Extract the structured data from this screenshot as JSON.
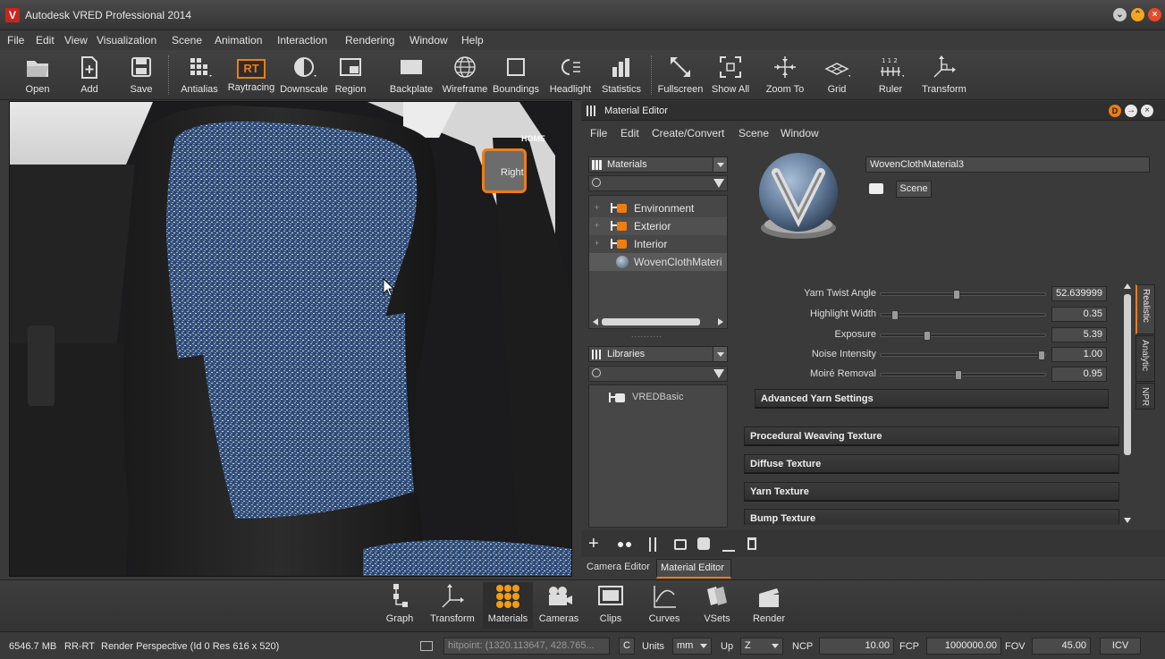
{
  "window": {
    "title": "Autodesk VRED Professional 2014",
    "logo_letter": "V"
  },
  "menubar": [
    "File",
    "Edit",
    "View",
    "Visualization",
    "Scene",
    "Animation",
    "Interaction",
    "Rendering",
    "Window",
    "Help"
  ],
  "toolbar": {
    "open": "Open",
    "add": "Add",
    "save": "Save",
    "antialias": "Antialias",
    "raytracing": "Raytracing",
    "raytracing_badge": "RT",
    "downscale": "Downscale",
    "region": "Region",
    "backplate": "Backplate",
    "wireframe": "Wireframe",
    "boundings": "Boundings",
    "headlight": "Headlight",
    "statistics": "Statistics",
    "fullscreen": "Fullscreen",
    "show_all": "Show All",
    "zoom_to": "Zoom To",
    "grid": "Grid",
    "ruler": "Ruler",
    "ruler_digits": "1 1 2",
    "transform": "Transform"
  },
  "viewport": {
    "navcube_face": "Right",
    "navcube_home": "HOME"
  },
  "material_editor": {
    "title": "Material Editor",
    "title_badge": "D",
    "menu": [
      "File",
      "Edit",
      "Create/Convert",
      "Scene",
      "Window"
    ],
    "materials_combo": "Materials",
    "material_tree": [
      "Environment",
      "Exterior",
      "Interior",
      "WovenClothMateri"
    ],
    "scrollbar_dots": "..........",
    "libraries_combo": "Libraries",
    "library_tree": [
      "VREDBasic"
    ],
    "material_name": "WovenClothMaterial3",
    "scene_button": "Scene",
    "properties": [
      {
        "label": "Yarn Twist Angle",
        "value": "52.639999",
        "level": 0.46
      },
      {
        "label": "Highlight Width",
        "value": "0.35",
        "level": 0.07
      },
      {
        "label": "Exposure",
        "value": "5.39",
        "level": 0.27
      },
      {
        "label": "Noise Intensity",
        "value": "1.00",
        "level": 1.0
      },
      {
        "label": "Moiré Removal",
        "value": "0.95",
        "level": 0.47
      }
    ],
    "sections": [
      "Advanced Yarn Settings",
      "Procedural Weaving Texture",
      "Diffuse Texture",
      "Yarn Texture",
      "Bump Texture"
    ],
    "side_tabs": [
      "Realistic",
      "Analytic",
      "NPR"
    ],
    "bottom_tabs": [
      "Camera Editor",
      "Material Editor"
    ]
  },
  "dock": [
    "Graph",
    "Transform",
    "Materials",
    "Cameras",
    "Clips",
    "Curves",
    "VSets",
    "Render"
  ],
  "statusbar": {
    "memory": "6546.7 MB",
    "mode": "RR-RT",
    "render_info": "Render Perspective (Id 0 Res 616 x 520)",
    "hitpoint": "hitpoint: (1320.113647, 428.765...",
    "c_button": "C",
    "units_label": "Units",
    "units_value": "mm",
    "up_label": "Up",
    "up_value": "Z",
    "ncp_label": "NCP",
    "ncp_value": "10.00",
    "fcp_label": "FCP",
    "fcp_value": "1000000.00",
    "fov_label": "FOV",
    "fov_value": "45.00",
    "icv_button": "ICV"
  },
  "colors": {
    "accent": "#ef7d12",
    "dark_bg": "#3a3a3a",
    "active_dock": "#f39c12"
  }
}
